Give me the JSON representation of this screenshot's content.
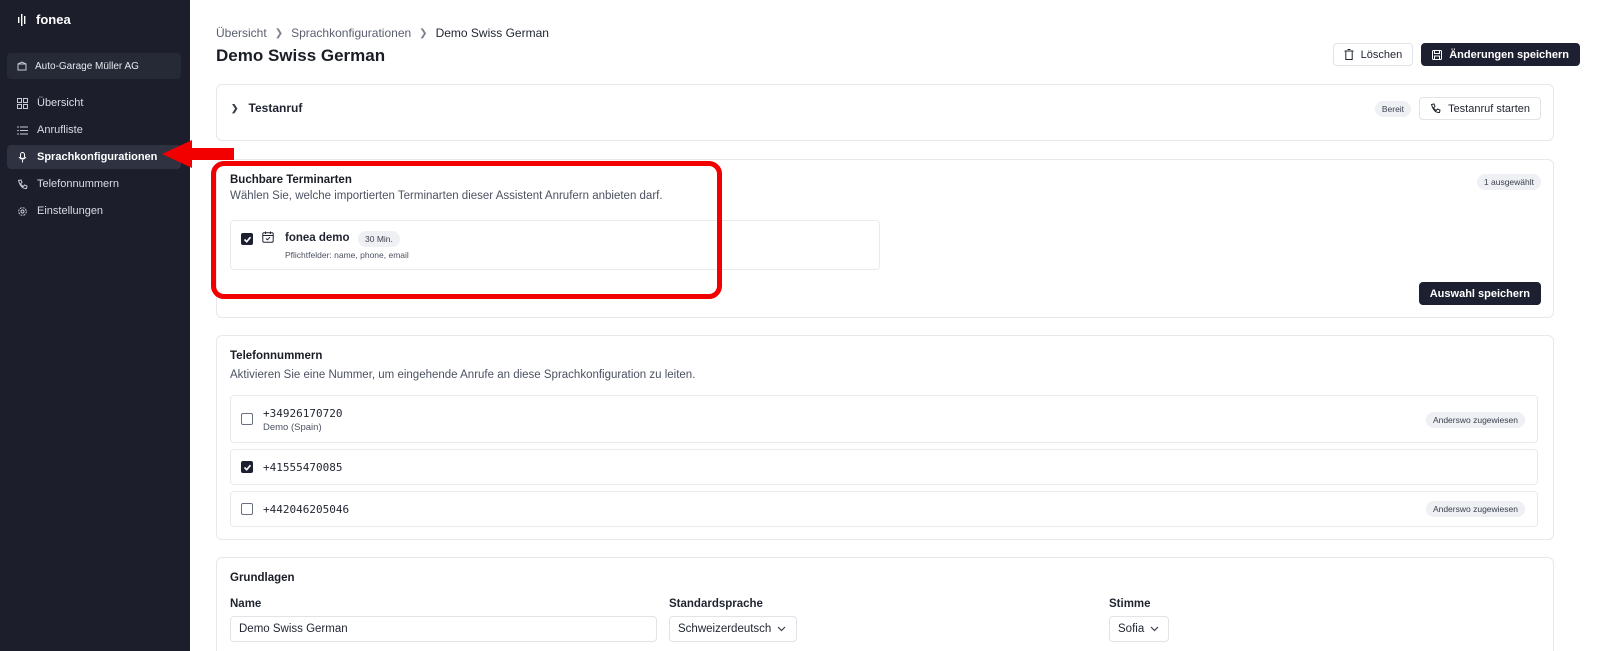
{
  "app": {
    "logo_text": "fonea"
  },
  "sidebar": {
    "org_name": "Auto-Garage Müller AG",
    "items": [
      {
        "label": "Übersicht",
        "icon": "grid-icon",
        "active": false
      },
      {
        "label": "Anrufliste",
        "icon": "list-icon",
        "active": false
      },
      {
        "label": "Sprachkonfigurationen",
        "icon": "microphone-icon",
        "active": true
      },
      {
        "label": "Telefonnummern",
        "icon": "phone-icon",
        "active": false
      },
      {
        "label": "Einstellungen",
        "icon": "gear-icon",
        "active": false
      }
    ]
  },
  "breadcrumb": [
    "Übersicht",
    "Sprachkonfigurationen",
    "Demo Swiss German"
  ],
  "page": {
    "title": "Demo Swiss German",
    "delete_label": "Löschen",
    "save_changes_label": "Änderungen speichern"
  },
  "testanruf": {
    "title": "Testanruf",
    "status": "Bereit",
    "start_label": "Testanruf starten"
  },
  "termine": {
    "title": "Buchbare Terminarten",
    "description": "Wählen Sie, welche importierten Terminarten dieser Assistent Anrufern anbieten darf.",
    "selected_count": "1 ausgewählt",
    "items": [
      {
        "name": "fonea demo",
        "duration": "30 Min.",
        "required": "Pflichtfelder: name, phone, email",
        "checked": true
      }
    ],
    "save_label": "Auswahl speichern"
  },
  "phones": {
    "title": "Telefonnummern",
    "description": "Aktivieren Sie eine Nummer, um eingehende Anrufe an diese Sprachkonfiguration zu leiten.",
    "items": [
      {
        "number": "+34926170720",
        "sub": "Demo (Spain)",
        "checked": false,
        "badge": "Anderswo zugewiesen"
      },
      {
        "number": "+41555470085",
        "sub": "",
        "checked": true,
        "badge": ""
      },
      {
        "number": "+442046205046",
        "sub": "",
        "checked": false,
        "badge": "Anderswo zugewiesen"
      }
    ]
  },
  "grundlagen": {
    "title": "Grundlagen",
    "name_label": "Name",
    "name_value": "Demo Swiss German",
    "language_label": "Standardsprache",
    "language_value": "Schweizerdeutsch",
    "voice_label": "Stimme",
    "voice_value": "Sofia"
  },
  "colors": {
    "sidebar_bg": "#1c1f2b",
    "accent_dark": "#1d2030",
    "annotation_red": "#f20000"
  }
}
